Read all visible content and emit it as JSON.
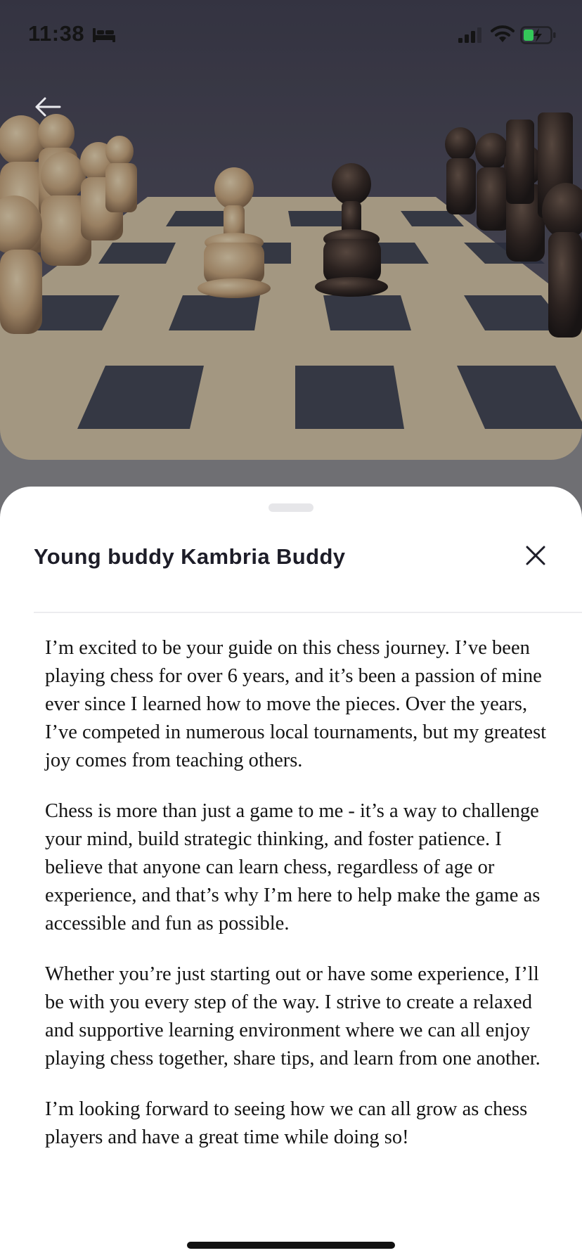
{
  "status_bar": {
    "time": "11:38",
    "icons": [
      "bed-icon",
      "cellular-signal-icon",
      "wifi-icon",
      "battery-charging-icon"
    ]
  },
  "hero": {
    "image": "chessboard-with-pawns",
    "back_icon": "arrow-left-icon"
  },
  "sheet": {
    "title": "Young buddy Kambria Buddy",
    "close_icon": "close-icon",
    "paragraphs": [
      "I’m excited to be your guide on this chess journey. I’ve been playing chess for over 6 years, and it’s been a passion of mine ever since I learned how to move the pieces. Over the years, I’ve competed in numerous local tournaments, but my greatest joy comes from teaching others.",
      "Chess is more than just a game to me - it’s a way to challenge your mind, build strategic thinking, and foster patience. I believe that anyone can learn chess, regardless of age or experience, and that’s why I’m here to help make the game as accessible and fun as possible.",
      "Whether you’re just starting out or have some experience, I’ll be with you every step of the way. I strive to create a relaxed and supportive learning environment where we can all enjoy playing chess together, share tips, and learn from one another.",
      "I’m looking forward to seeing how we can all grow as chess players and have a great time while doing so!"
    ]
  },
  "colors": {
    "sheet_background": "#ffffff",
    "title_text": "#1d1d28",
    "body_text": "#141414",
    "backdrop": "#6f6f73",
    "battery_fill": "#34c759"
  }
}
